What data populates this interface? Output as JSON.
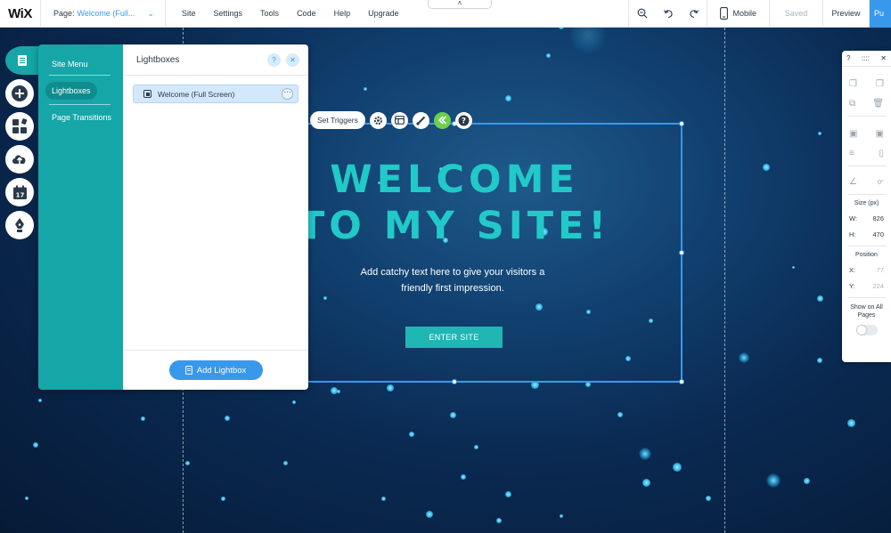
{
  "topbar": {
    "logo": "WiX",
    "page_label": "Page:",
    "page_value": "Welcome (Full...",
    "menu": [
      "Site",
      "Settings",
      "Tools",
      "Code",
      "Help",
      "Upgrade"
    ],
    "mobile_label": "Mobile",
    "saved_label": "Saved",
    "preview_label": "Preview",
    "publish_label": "Pu"
  },
  "panel": {
    "nav": [
      "Site Menu",
      "Lightboxes",
      "Page Transitions"
    ],
    "title": "Lightboxes",
    "item": "Welcome (Full Screen)",
    "add_button": "Add Lightbox"
  },
  "canvas": {
    "set_triggers": "Set Triggers",
    "headline_line1": "WELCOME",
    "headline_line2": "TO MY SITE!",
    "subtext": "Add catchy text here to give your visitors a friendly first impression.",
    "enter_button": "ENTER SITE"
  },
  "inspector": {
    "rotation": "0°",
    "size_label": "Size (px)",
    "w_label": "W:",
    "w_value": "826",
    "h_label": "H:",
    "h_value": "470",
    "position_label": "Position",
    "x_label": "X:",
    "x_value": "77",
    "y_label": "Y:",
    "y_value": "224",
    "show_all": "Show on All Pages"
  },
  "colors": {
    "accent": "#3899ec",
    "teal": "#16a6a8",
    "headline": "#22c9c9"
  }
}
